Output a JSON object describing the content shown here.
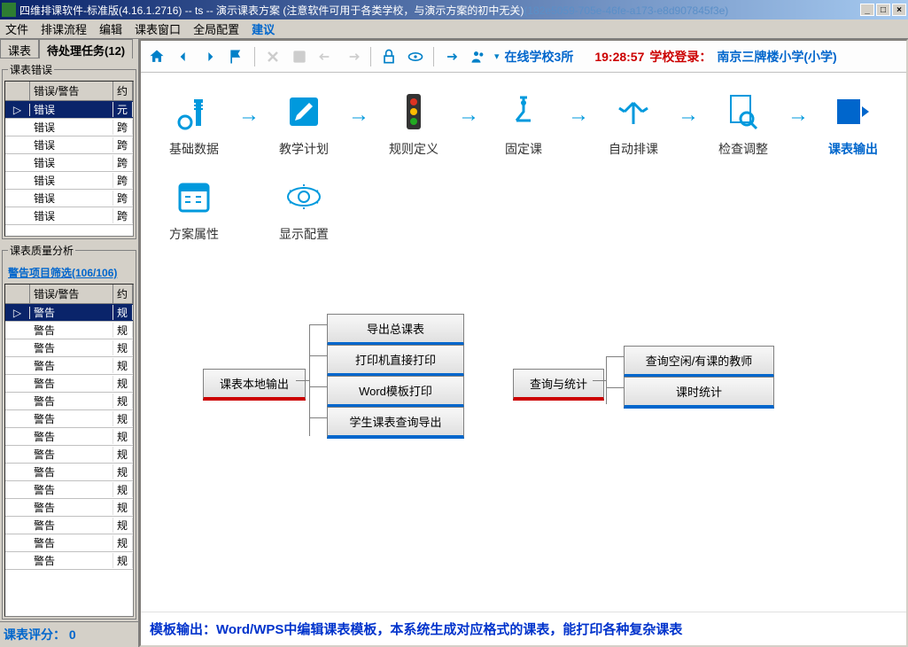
{
  "window": {
    "title_main": "四维排课软件-标准版(4.16.1.2716) -- ts -- 演示课表方案 (注意软件可用于各类学校，与演示方案的初中无关)",
    "title_id": "(182e5059-705e-46fe-a173-e8d907845f3e)"
  },
  "menu": {
    "file": "文件",
    "process": "排课流程",
    "edit": "编辑",
    "window": "课表窗口",
    "global": "全局配置",
    "suggest": "建议"
  },
  "sidebar": {
    "tab1": "课表",
    "tab2": "待处理任务(12)",
    "group1": "课表错误",
    "group2": "课表质量分析",
    "header_ew": "错误/警告",
    "header_end": "约",
    "filter_link": "警告项目筛选(106/106)",
    "errors": [
      {
        "mark": "▷",
        "type": "错误",
        "end": "元",
        "sel": true
      },
      {
        "mark": "",
        "type": "错误",
        "end": "跨"
      },
      {
        "mark": "",
        "type": "错误",
        "end": "跨"
      },
      {
        "mark": "",
        "type": "错误",
        "end": "跨"
      },
      {
        "mark": "",
        "type": "错误",
        "end": "跨"
      },
      {
        "mark": "",
        "type": "错误",
        "end": "跨"
      },
      {
        "mark": "",
        "type": "错误",
        "end": "跨"
      }
    ],
    "warnings": [
      {
        "mark": "▷",
        "type": "警告",
        "end": "规",
        "sel": true
      },
      {
        "mark": "",
        "type": "警告",
        "end": "规"
      },
      {
        "mark": "",
        "type": "警告",
        "end": "规"
      },
      {
        "mark": "",
        "type": "警告",
        "end": "规"
      },
      {
        "mark": "",
        "type": "警告",
        "end": "规"
      },
      {
        "mark": "",
        "type": "警告",
        "end": "规"
      },
      {
        "mark": "",
        "type": "警告",
        "end": "规"
      },
      {
        "mark": "",
        "type": "警告",
        "end": "规"
      },
      {
        "mark": "",
        "type": "警告",
        "end": "规"
      },
      {
        "mark": "",
        "type": "警告",
        "end": "规"
      },
      {
        "mark": "",
        "type": "警告",
        "end": "规"
      },
      {
        "mark": "",
        "type": "警告",
        "end": "规"
      },
      {
        "mark": "",
        "type": "警告",
        "end": "规"
      },
      {
        "mark": "",
        "type": "警告",
        "end": "规"
      },
      {
        "mark": "",
        "type": "警告",
        "end": "规"
      }
    ],
    "score": "课表评分： 0"
  },
  "toolbar": {
    "online": "在线学校3所",
    "time": "19:28:57",
    "login_label": "学校登录：",
    "login_school": "南京三牌楼小学(小学)"
  },
  "steps": {
    "s1": "基础数据",
    "s2": "教学计划",
    "s3": "规则定义",
    "s4": "固定课",
    "s5": "自动排课",
    "s6": "检查调整",
    "s7": "课表输出",
    "r2a": "方案属性",
    "r2b": "显示配置"
  },
  "diagram": {
    "left_root": "课表本地输出",
    "left_items": [
      "导出总课表",
      "打印机直接打印",
      "Word模板打印",
      "学生课表查询导出"
    ],
    "right_root": "查询与统计",
    "right_items": [
      "查询空闲/有课的教师",
      "课时统计"
    ]
  },
  "footer": "模板输出：Word/WPS中编辑课表模板，本系统生成对应格式的课表，能打印各种复杂课表"
}
